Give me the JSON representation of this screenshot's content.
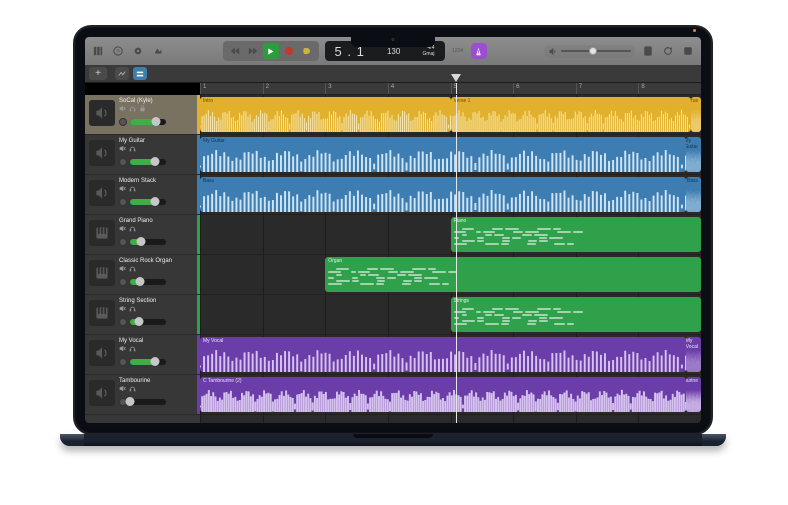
{
  "toolbar": {
    "position": "5 . 1",
    "tempo": "130",
    "time_sig": "4/4",
    "key": "Gmaj",
    "countin_label": "1234"
  },
  "ruler": {
    "bars": [
      "1",
      "2",
      "3",
      "4",
      "5",
      "6",
      "7",
      "8"
    ]
  },
  "tracks": [
    {
      "name": "SoCal (Kyle)",
      "color": "#e1b12e",
      "volume": 0.72,
      "selected": true,
      "type": "audio"
    },
    {
      "name": "My Guitar",
      "color": "#3d7db2",
      "volume": 0.7,
      "selected": false,
      "type": "audio"
    },
    {
      "name": "Modern Stack",
      "color": "#3d7db2",
      "volume": 0.7,
      "selected": false,
      "type": "audio"
    },
    {
      "name": "Grand Piano",
      "color": "#2fa14a",
      "volume": 0.3,
      "selected": false,
      "type": "midi"
    },
    {
      "name": "Classic Rock Organ",
      "color": "#2fa14a",
      "volume": 0.28,
      "selected": false,
      "type": "midi"
    },
    {
      "name": "String Section",
      "color": "#2fa14a",
      "volume": 0.26,
      "selected": false,
      "type": "midi"
    },
    {
      "name": "My Vocal",
      "color": "#6b3da8",
      "volume": 0.7,
      "selected": false,
      "type": "audio"
    },
    {
      "name": "Tambourine",
      "color": "#6b3da8",
      "volume": 0.0,
      "selected": false,
      "type": "audio"
    }
  ],
  "regions": [
    {
      "track": 0,
      "start": 0,
      "end": 0.5,
      "label": "Intro",
      "labelSide": "left",
      "color": "yellow",
      "kind": "wave"
    },
    {
      "track": 0,
      "start": 0.5,
      "end": 0.98,
      "label": "Verse 1",
      "labelSide": "left",
      "color": "yellow",
      "kind": "wave"
    },
    {
      "track": 0,
      "start": 0.98,
      "end": 1.0,
      "label": "Chorus",
      "labelSide": "right",
      "color": "yellow",
      "kind": "wave"
    },
    {
      "track": 1,
      "start": 0,
      "end": 0.97,
      "label": "My Guitar",
      "labelSide": "left",
      "color": "blue",
      "kind": "wave"
    },
    {
      "track": 1,
      "start": 0.97,
      "end": 1.0,
      "label": "My Guitar",
      "labelSide": "right",
      "color": "blue",
      "kind": "wave"
    },
    {
      "track": 2,
      "start": 0,
      "end": 0.97,
      "label": "Bass",
      "labelSide": "left",
      "color": "blue",
      "kind": "wave"
    },
    {
      "track": 2,
      "start": 0.97,
      "end": 1.0,
      "label": "Bass",
      "labelSide": "right",
      "color": "blue",
      "kind": "wave"
    },
    {
      "track": 3,
      "start": 0.5,
      "end": 1.0,
      "label": "Piano",
      "labelSide": "left",
      "color": "green",
      "kind": "midi"
    },
    {
      "track": 4,
      "start": 0.25,
      "end": 1.0,
      "label": "Organ",
      "labelSide": "left",
      "color": "green",
      "kind": "midi"
    },
    {
      "track": 5,
      "start": 0.5,
      "end": 1.0,
      "label": "Strings",
      "labelSide": "left",
      "color": "green",
      "kind": "midi"
    },
    {
      "track": 6,
      "start": 0,
      "end": 0.97,
      "label": "My Vocal",
      "labelSide": "left",
      "color": "purple",
      "kind": "wave"
    },
    {
      "track": 6,
      "start": 0.97,
      "end": 1.0,
      "label": "My Vocal",
      "labelSide": "right",
      "color": "purple",
      "kind": "wave"
    },
    {
      "track": 7,
      "start": 0,
      "end": 0.97,
      "label": "C Tambourine   (2)",
      "labelSide": "left",
      "color": "purple",
      "kind": "wave-dense"
    },
    {
      "track": 7,
      "start": 0.97,
      "end": 1.0,
      "label": "Tambourine",
      "labelSide": "right",
      "color": "purple",
      "kind": "wave-dense"
    }
  ],
  "playhead_position": 0.51,
  "icons": {
    "library": "library",
    "browser": "browser",
    "smart": "smart-controls",
    "editors": "editors",
    "rewind": "go-to-beginning",
    "prev": "back",
    "play": "play",
    "rec": "record",
    "cycle": "cycle",
    "mute": "mute",
    "solo": "headphones",
    "lock": "lock",
    "notepad": "notepad",
    "loop": "loop-browser",
    "media": "media-browser"
  }
}
